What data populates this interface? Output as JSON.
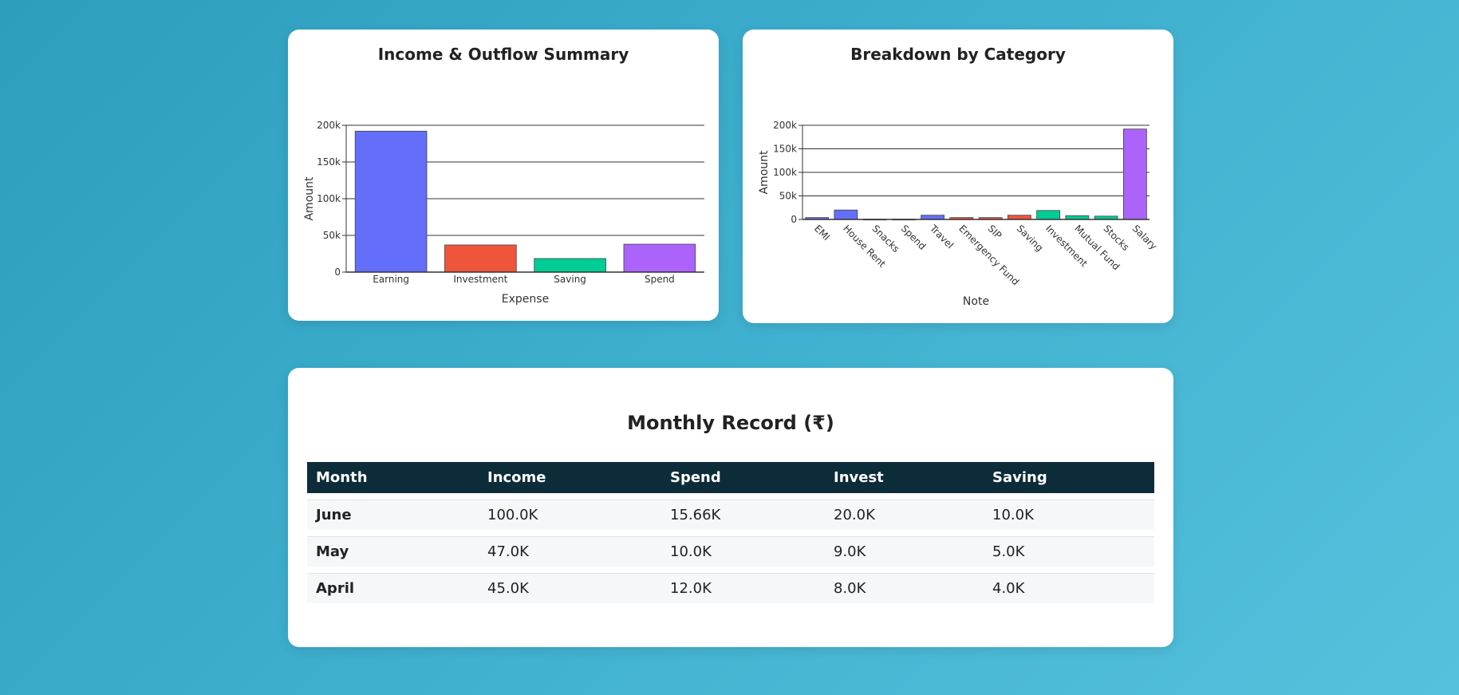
{
  "chart_data": [
    {
      "type": "bar",
      "title": "Income & Outflow Summary",
      "xlabel": "Expense",
      "ylabel": "Amount",
      "categories": [
        "Earning",
        "Investment",
        "Saving",
        "Spend"
      ],
      "values": [
        192000,
        37000,
        18500,
        38000
      ],
      "colors": [
        "#636efa",
        "#ef553b",
        "#00cc96",
        "#ab63fa"
      ],
      "ylim": [
        0,
        200000
      ],
      "yticks": [
        0,
        50000,
        100000,
        150000,
        200000
      ],
      "ytick_labels": [
        "0",
        "50k",
        "100k",
        "150k",
        "200k"
      ],
      "grid": true
    },
    {
      "type": "bar",
      "title": "Breakdown by Category",
      "xlabel": "Note",
      "ylabel": "Amount",
      "categories": [
        "EMI",
        "House Rent",
        "Snacks",
        "Spend",
        "Travel",
        "Emergency Fund",
        "SIP",
        "Saving",
        "Investment",
        "Mutual Fund",
        "Stocks",
        "Salary"
      ],
      "values": [
        4000,
        20000,
        500,
        500,
        9000,
        4000,
        4000,
        9000,
        19000,
        8000,
        7000,
        192000
      ],
      "colors": [
        "#636efa",
        "#636efa",
        "#636efa",
        "#636efa",
        "#636efa",
        "#ef553b",
        "#ef553b",
        "#ef553b",
        "#00cc96",
        "#00cc96",
        "#00cc96",
        "#ab63fa"
      ],
      "ylim": [
        0,
        200000
      ],
      "yticks": [
        0,
        50000,
        100000,
        150000,
        200000
      ],
      "ytick_labels": [
        "0",
        "50k",
        "100k",
        "150k",
        "200k"
      ],
      "grid": true
    }
  ],
  "table": {
    "title": "Monthly Record (₹)",
    "headers": [
      "Month",
      "Income",
      "Spend",
      "Invest",
      "Saving"
    ],
    "rows": [
      [
        "June",
        "100.0K",
        "15.66K",
        "20.0K",
        "10.0K"
      ],
      [
        "May",
        "47.0K",
        "10.0K",
        "9.0K",
        "5.0K"
      ],
      [
        "April",
        "45.0K",
        "12.0K",
        "8.0K",
        "4.0K"
      ]
    ]
  }
}
